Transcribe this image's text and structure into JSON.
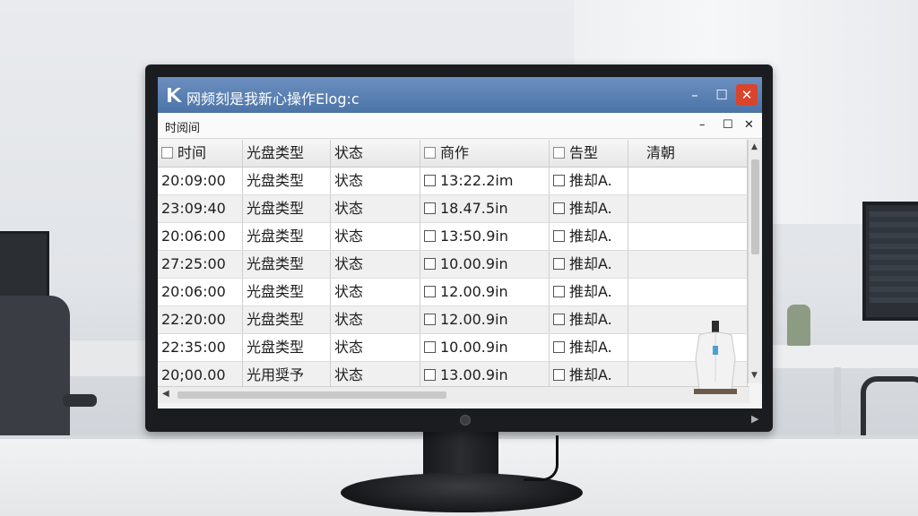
{
  "window": {
    "title": "网频刻是我新心操作Elog:c",
    "controls": {
      "minimize": "–",
      "maximize": "☐",
      "close": "✕"
    }
  },
  "menu": {
    "item": "时阅间",
    "ctrl_min": "–",
    "ctrl_max": "☐",
    "ctrl_close": "✕"
  },
  "table": {
    "headers": [
      "时间",
      "光盘类型",
      "状态",
      "商作",
      "告型",
      "清朝"
    ],
    "rows": [
      [
        "20:09:00",
        "光盘类型",
        "状态",
        "13:22.2im",
        "推却A."
      ],
      [
        "23:09:40",
        "光盘类型",
        "状态",
        "18.47.5in",
        "推却A."
      ],
      [
        "20:06:00",
        "光盘类型",
        "状态",
        "13:50.9in",
        "推却A."
      ],
      [
        "27:25:00",
        "光盘类型",
        "状态",
        "10.00.9in",
        "推却A."
      ],
      [
        "20:06:00",
        "光盘类型",
        "状态",
        "12.00.9in",
        "推却A."
      ],
      [
        "22:20:00",
        "光盘类型",
        "状态",
        "12.00.9in",
        "推却A."
      ],
      [
        "22:35:00",
        "光盘类型",
        "状态",
        "10.00.9in",
        "推却A."
      ],
      [
        "20;00.00",
        "光用奨予",
        "状态",
        "13.00.9in",
        "推却A."
      ]
    ]
  },
  "colors": {
    "titlebar": "#4c74a8",
    "close_button": "#d9442d"
  }
}
